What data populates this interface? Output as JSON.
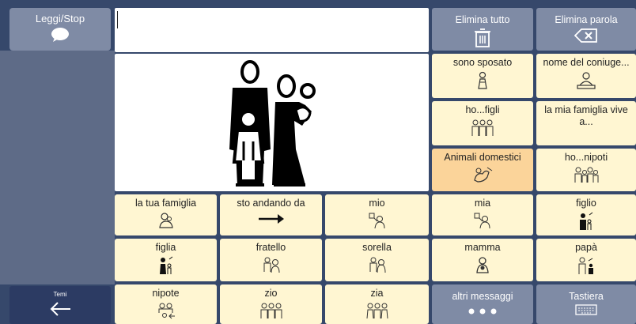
{
  "toolbar": {
    "speak_label": "Leggi/Stop",
    "delete_all_label": "Elimina tutto",
    "delete_word_label": "Elimina parola"
  },
  "message": {
    "value": ""
  },
  "sidebar": {
    "themes_label": "Temi"
  },
  "right_grid": [
    {
      "label": "sono sposato",
      "icon": "married-person-icon"
    },
    {
      "label": "nome del coniuge...",
      "icon": "spouse-icon"
    },
    {
      "label": "ho...figli",
      "icon": "children-icon"
    },
    {
      "label": "la mia famiglia vive a...",
      "icon": "family-home-icon"
    },
    {
      "label": "Animali domestici",
      "icon": "pets-icon"
    },
    {
      "label": "ho...nipoti",
      "icon": "grandchildren-icon"
    }
  ],
  "main_grid": [
    {
      "label": "la tua famiglia",
      "icon": "family-hug-icon"
    },
    {
      "label": "sto andando da",
      "icon": "arrow-right-icon"
    },
    {
      "label": "mio",
      "icon": "mine-icon"
    },
    {
      "label": "mia",
      "icon": "mine-icon"
    },
    {
      "label": "figlio",
      "icon": "son-icon"
    },
    {
      "label": "figlia",
      "icon": "daughter-icon"
    },
    {
      "label": "fratello",
      "icon": "brother-icon"
    },
    {
      "label": "sorella",
      "icon": "sister-icon"
    },
    {
      "label": "mamma",
      "icon": "mother-icon"
    },
    {
      "label": "papà",
      "icon": "father-icon"
    },
    {
      "label": "nipote",
      "icon": "nephew-icon"
    },
    {
      "label": "zio",
      "icon": "uncle-icon"
    },
    {
      "label": "zia",
      "icon": "aunt-icon"
    }
  ],
  "bottom": {
    "more_messages_label": "altri messaggi",
    "keyboard_label": "Tastiera"
  },
  "colors": {
    "background": "#36486b",
    "cell": "#fff6d2",
    "highlight": "#fbd49a",
    "gray_button": "#7f8ba5"
  }
}
